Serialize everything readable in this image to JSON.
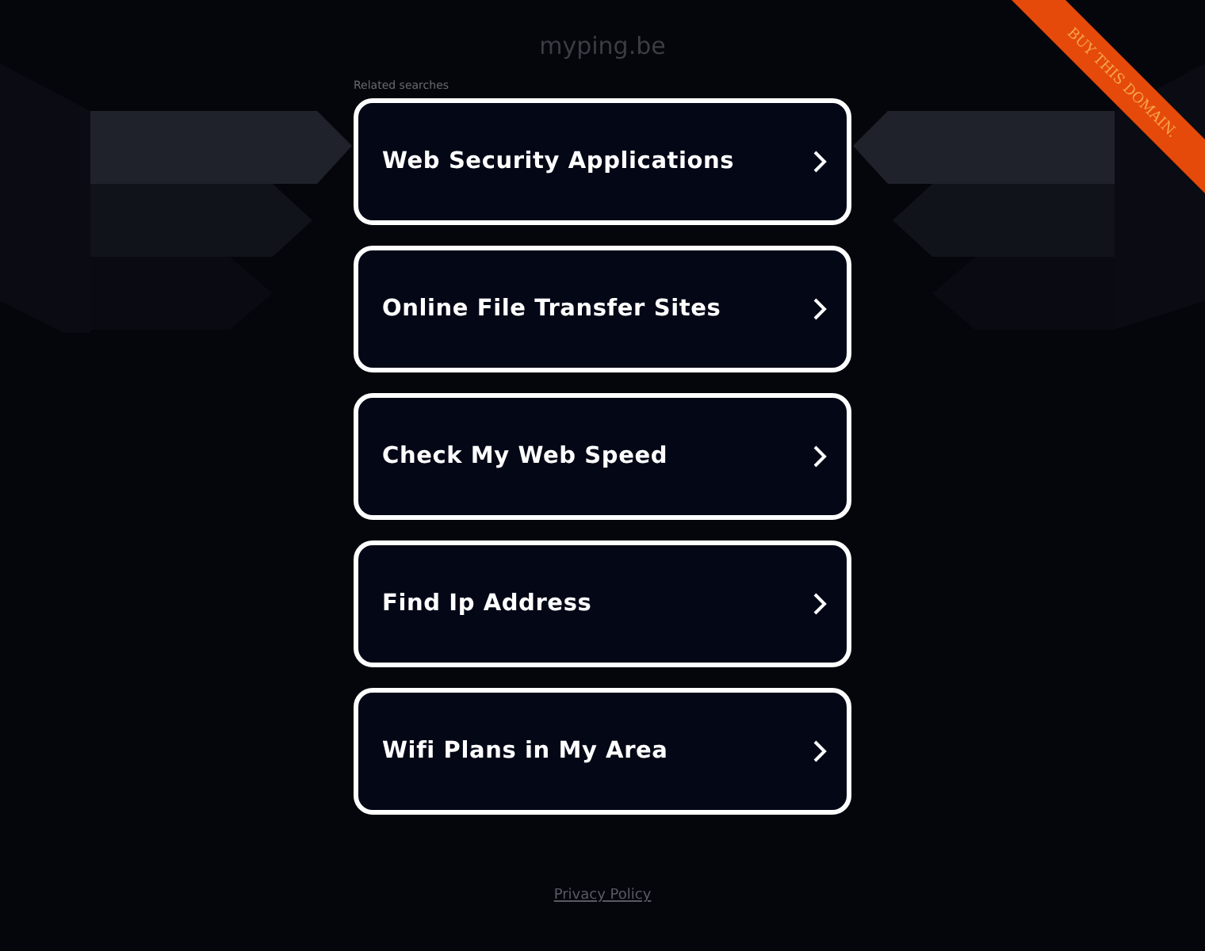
{
  "domain_title": "myping.be",
  "ribbon": {
    "label": "BUY THIS DOMAIN."
  },
  "related_heading": "Related searches",
  "links": [
    {
      "label": "Web Security Applications"
    },
    {
      "label": "Online File Transfer Sites"
    },
    {
      "label": "Check My Web Speed"
    },
    {
      "label": "Find Ip Address"
    },
    {
      "label": "Wifi Plans in My Area"
    }
  ],
  "footer_link": "Privacy Policy"
}
